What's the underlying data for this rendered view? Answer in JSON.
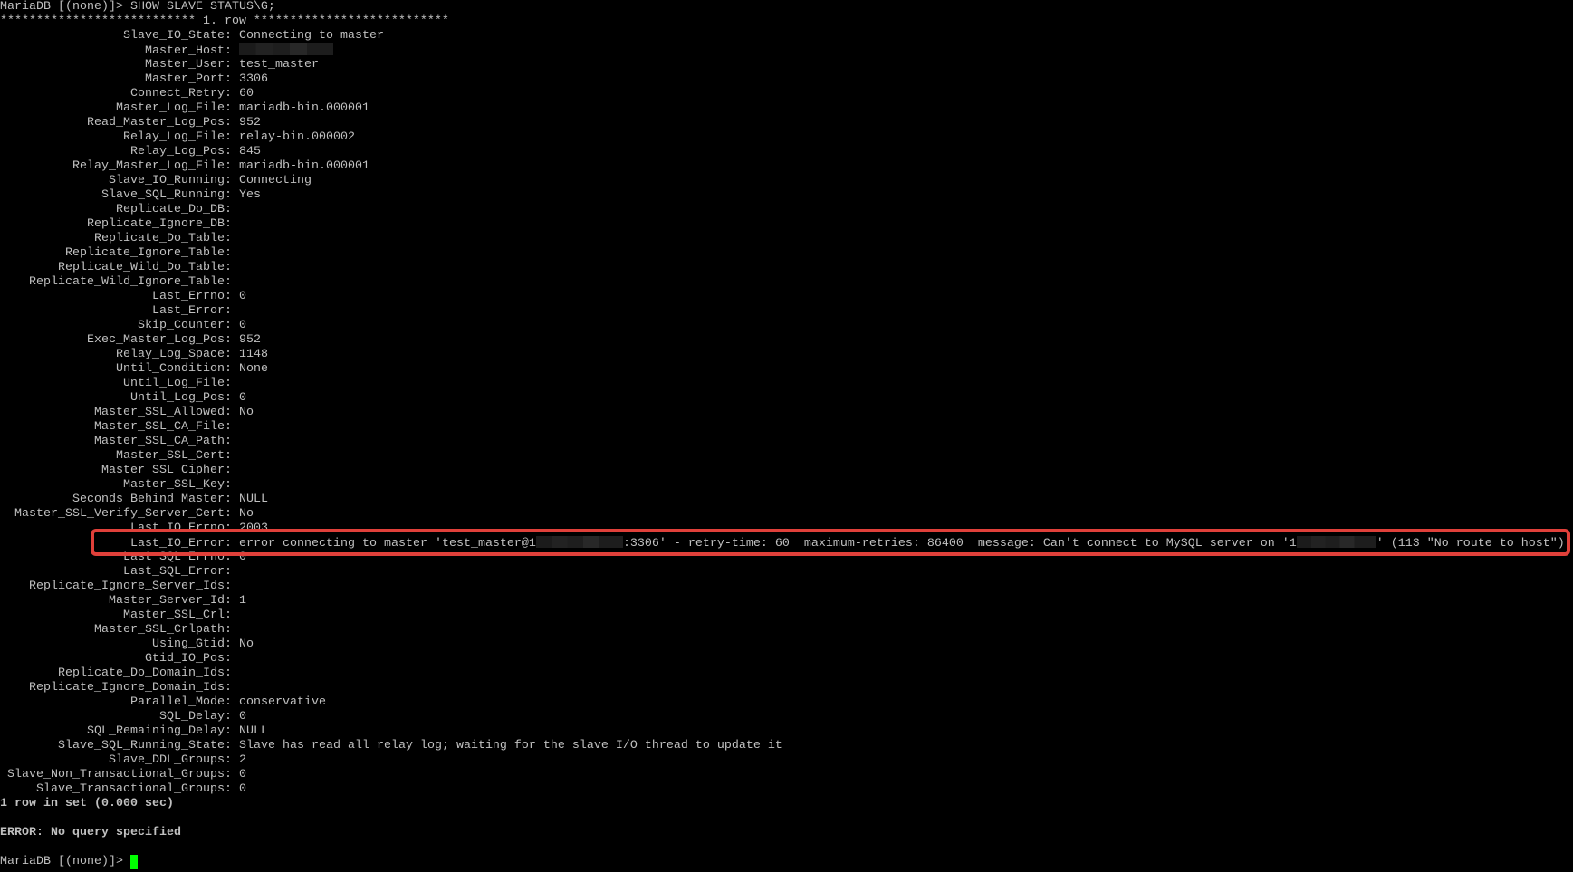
{
  "terminal": {
    "command_line": {
      "prompt": "MariaDB [(none)]> ",
      "command": "SHOW SLAVE STATUS\\G;"
    },
    "row_header": "*************************** 1. row ***************************",
    "fields": [
      {
        "label": "Slave_IO_State:",
        "value": "Connecting to master"
      },
      {
        "label": "Master_Host:",
        "value": "",
        "redacted": true
      },
      {
        "label": "Master_User:",
        "value": "test_master"
      },
      {
        "label": "Master_Port:",
        "value": "3306"
      },
      {
        "label": "Connect_Retry:",
        "value": "60"
      },
      {
        "label": "Master_Log_File:",
        "value": "mariadb-bin.000001"
      },
      {
        "label": "Read_Master_Log_Pos:",
        "value": "952"
      },
      {
        "label": "Relay_Log_File:",
        "value": "relay-bin.000002"
      },
      {
        "label": "Relay_Log_Pos:",
        "value": "845"
      },
      {
        "label": "Relay_Master_Log_File:",
        "value": "mariadb-bin.000001"
      },
      {
        "label": "Slave_IO_Running:",
        "value": "Connecting"
      },
      {
        "label": "Slave_SQL_Running:",
        "value": "Yes"
      },
      {
        "label": "Replicate_Do_DB:",
        "value": ""
      },
      {
        "label": "Replicate_Ignore_DB:",
        "value": ""
      },
      {
        "label": "Replicate_Do_Table:",
        "value": ""
      },
      {
        "label": "Replicate_Ignore_Table:",
        "value": ""
      },
      {
        "label": "Replicate_Wild_Do_Table:",
        "value": ""
      },
      {
        "label": "Replicate_Wild_Ignore_Table:",
        "value": ""
      },
      {
        "label": "Last_Errno:",
        "value": "0"
      },
      {
        "label": "Last_Error:",
        "value": ""
      },
      {
        "label": "Skip_Counter:",
        "value": "0"
      },
      {
        "label": "Exec_Master_Log_Pos:",
        "value": "952"
      },
      {
        "label": "Relay_Log_Space:",
        "value": "1148"
      },
      {
        "label": "Until_Condition:",
        "value": "None"
      },
      {
        "label": "Until_Log_File:",
        "value": ""
      },
      {
        "label": "Until_Log_Pos:",
        "value": "0"
      },
      {
        "label": "Master_SSL_Allowed:",
        "value": "No"
      },
      {
        "label": "Master_SSL_CA_File:",
        "value": ""
      },
      {
        "label": "Master_SSL_CA_Path:",
        "value": ""
      },
      {
        "label": "Master_SSL_Cert:",
        "value": ""
      },
      {
        "label": "Master_SSL_Cipher:",
        "value": ""
      },
      {
        "label": "Master_SSL_Key:",
        "value": ""
      },
      {
        "label": "Seconds_Behind_Master:",
        "value": "NULL"
      },
      {
        "label": "Master_SSL_Verify_Server_Cert:",
        "value": "No"
      },
      {
        "label": "Last_IO_Errno:",
        "value": "2003"
      }
    ],
    "io_error": {
      "label": "Last_IO_Error:",
      "part1": "error connecting to master 'test_master@1",
      "part2": ":3306' - retry-time: 60  maximum-retries: 86400  message: Can't connect to MySQL server on '1",
      "part3": "' (113 \"No route to host\")",
      "highlight_color": "#e0403a"
    },
    "fields_after": [
      {
        "label": "Last_SQL_Errno:",
        "value": "0"
      },
      {
        "label": "Last_SQL_Error:",
        "value": ""
      },
      {
        "label": "Replicate_Ignore_Server_Ids:",
        "value": ""
      },
      {
        "label": "Master_Server_Id:",
        "value": "1"
      },
      {
        "label": "Master_SSL_Crl:",
        "value": ""
      },
      {
        "label": "Master_SSL_Crlpath:",
        "value": ""
      },
      {
        "label": "Using_Gtid:",
        "value": "No"
      },
      {
        "label": "Gtid_IO_Pos:",
        "value": ""
      },
      {
        "label": "Replicate_Do_Domain_Ids:",
        "value": ""
      },
      {
        "label": "Replicate_Ignore_Domain_Ids:",
        "value": ""
      },
      {
        "label": "Parallel_Mode:",
        "value": "conservative"
      },
      {
        "label": "SQL_Delay:",
        "value": "0"
      },
      {
        "label": "SQL_Remaining_Delay:",
        "value": "NULL"
      },
      {
        "label": "Slave_SQL_Running_State:",
        "value": "Slave has read all relay log; waiting for the slave I/O thread to update it"
      },
      {
        "label": "Slave_DDL_Groups:",
        "value": "2"
      },
      {
        "label": "Slave_Non_Transactional_Groups:",
        "value": "0"
      },
      {
        "label": "Slave_Transactional_Groups:",
        "value": "0"
      }
    ],
    "result_summary": "1 row in set (0.000 sec)",
    "error_message": "ERROR: No query specified",
    "final_prompt": "MariaDB [(none)]> ",
    "colors": {
      "background": "#000000",
      "foreground": "#c0c0c0",
      "cursor": "#00ff00"
    }
  }
}
